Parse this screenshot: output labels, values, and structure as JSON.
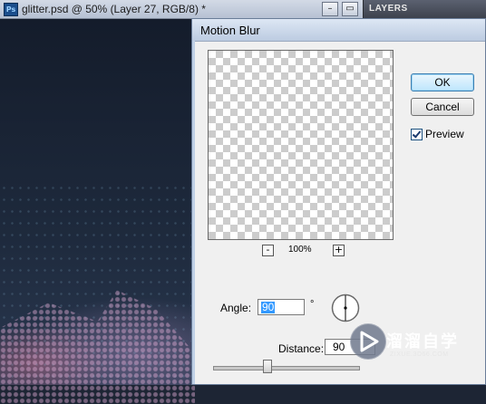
{
  "document": {
    "app_badge": "Ps",
    "title": "glitter.psd @ 50% (Layer 27, RGB/8) *",
    "minimize_glyph": "–",
    "restore_glyph": "▭"
  },
  "layers_panel": {
    "tab_label": "LAYERS"
  },
  "dialog": {
    "title": "Motion Blur",
    "ok_label": "OK",
    "cancel_label": "Cancel",
    "preview_label": "Preview",
    "preview_checked": true,
    "zoom_out_label": "-",
    "zoom_in_label": "+",
    "zoom_percent": "100%",
    "angle_label": "Angle:",
    "angle_value": "90",
    "degree_symbol": "°",
    "distance_label": "Distance:",
    "distance_value": "90",
    "distance_slider_fraction": 0.37
  },
  "watermark": {
    "text": "溜溜自学",
    "url": "ZIXUE.3D66.COM"
  },
  "colors": {
    "dialog_frame": "#bfd0e6",
    "ok_button": "#bee6fd",
    "selection": "#3399ff",
    "canvas_dark": "#1d2534"
  }
}
